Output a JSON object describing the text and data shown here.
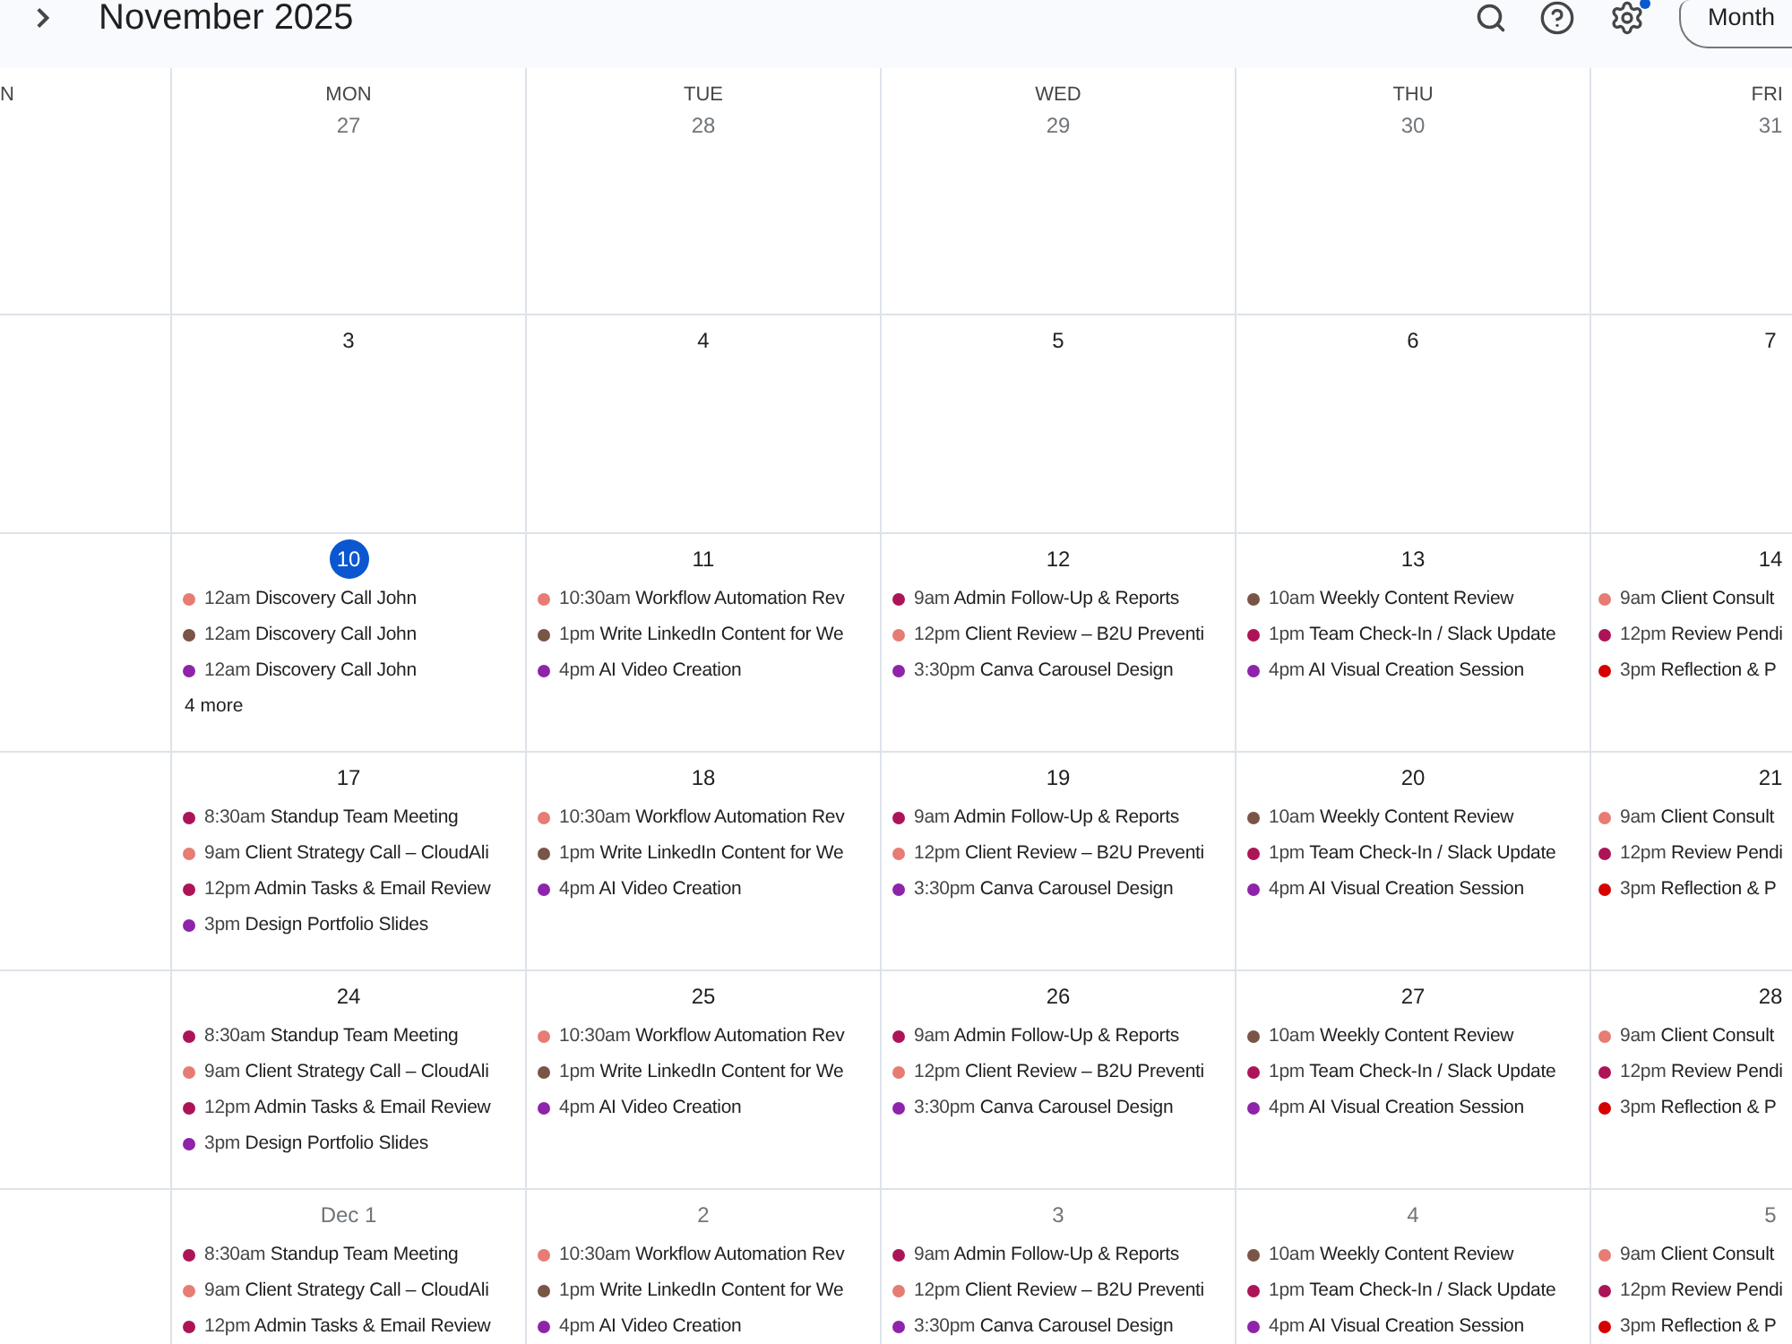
{
  "toolbar": {
    "title": "November 2025",
    "settings_badge": true,
    "view_button": "Month"
  },
  "weekdays": [
    "N",
    "MON",
    "TUE",
    "WED",
    "THU",
    "FRI"
  ],
  "weeks": [
    {
      "days": [
        {
          "date": "27",
          "outside_month": true,
          "today": false
        },
        {
          "date": "28",
          "outside_month": true,
          "today": false
        },
        {
          "date": "29",
          "outside_month": true,
          "today": false
        },
        {
          "date": "30",
          "outside_month": true,
          "today": false
        },
        {
          "date": "31",
          "outside_month": true,
          "today": false
        }
      ]
    },
    {
      "days": [
        {
          "date": "3",
          "outside_month": false,
          "today": false
        },
        {
          "date": "4",
          "outside_month": false,
          "today": false
        },
        {
          "date": "5",
          "outside_month": false,
          "today": false
        },
        {
          "date": "6",
          "outside_month": false,
          "today": false
        },
        {
          "date": "7",
          "outside_month": false,
          "today": false
        }
      ]
    },
    {
      "days": [
        {
          "date": "10",
          "outside_month": false,
          "today": true,
          "events": [
            {
              "time": "12am",
              "title": "Discovery Call John",
              "color": "#e67c73"
            },
            {
              "time": "12am",
              "title": "Discovery Call John",
              "color": "#795548"
            },
            {
              "time": "12am",
              "title": "Discovery Call John",
              "color": "#8e24aa"
            }
          ],
          "more": "4 more"
        },
        {
          "date": "11",
          "outside_month": false,
          "today": false,
          "events": [
            {
              "time": "10:30am",
              "title": "Workflow Automation Rev",
              "color": "#e67c73"
            },
            {
              "time": "1pm",
              "title": "Write LinkedIn Content for We",
              "color": "#795548"
            },
            {
              "time": "4pm",
              "title": "AI Video Creation",
              "color": "#8e24aa"
            }
          ]
        },
        {
          "date": "12",
          "outside_month": false,
          "today": false,
          "events": [
            {
              "time": "9am",
              "title": "Admin Follow-Up & Reports",
              "color": "#ad1457"
            },
            {
              "time": "12pm",
              "title": "Client Review – B2U Preventi",
              "color": "#e67c73"
            },
            {
              "time": "3:30pm",
              "title": "Canva Carousel Design",
              "color": "#8e24aa"
            }
          ]
        },
        {
          "date": "13",
          "outside_month": false,
          "today": false,
          "events": [
            {
              "time": "10am",
              "title": "Weekly Content Review",
              "color": "#795548"
            },
            {
              "time": "1pm",
              "title": "Team Check-In / Slack Update",
              "color": "#ad1457"
            },
            {
              "time": "4pm",
              "title": "AI Visual Creation Session",
              "color": "#8e24aa"
            }
          ]
        },
        {
          "date": "14",
          "outside_month": false,
          "today": false,
          "events": [
            {
              "time": "9am",
              "title": "Client Consult",
              "color": "#e67c73"
            },
            {
              "time": "12pm",
              "title": "Review Pendi",
              "color": "#ad1457"
            },
            {
              "time": "3pm",
              "title": "Reflection & P",
              "color": "#d50000"
            }
          ]
        }
      ]
    },
    {
      "days": [
        {
          "date": "17",
          "outside_month": false,
          "today": false,
          "events": [
            {
              "time": "8:30am",
              "title": "Standup Team Meeting",
              "color": "#ad1457"
            },
            {
              "time": "9am",
              "title": "Client Strategy Call – CloudAli",
              "color": "#e67c73"
            },
            {
              "time": "12pm",
              "title": "Admin Tasks & Email Review",
              "color": "#ad1457"
            },
            {
              "time": "3pm",
              "title": "Design Portfolio Slides",
              "color": "#8e24aa"
            }
          ]
        },
        {
          "date": "18",
          "outside_month": false,
          "today": false,
          "events": [
            {
              "time": "10:30am",
              "title": "Workflow Automation Rev",
              "color": "#e67c73"
            },
            {
              "time": "1pm",
              "title": "Write LinkedIn Content for We",
              "color": "#795548"
            },
            {
              "time": "4pm",
              "title": "AI Video Creation",
              "color": "#8e24aa"
            }
          ]
        },
        {
          "date": "19",
          "outside_month": false,
          "today": false,
          "events": [
            {
              "time": "9am",
              "title": "Admin Follow-Up & Reports",
              "color": "#ad1457"
            },
            {
              "time": "12pm",
              "title": "Client Review – B2U Preventi",
              "color": "#e67c73"
            },
            {
              "time": "3:30pm",
              "title": "Canva Carousel Design",
              "color": "#8e24aa"
            }
          ]
        },
        {
          "date": "20",
          "outside_month": false,
          "today": false,
          "events": [
            {
              "time": "10am",
              "title": "Weekly Content Review",
              "color": "#795548"
            },
            {
              "time": "1pm",
              "title": "Team Check-In / Slack Update",
              "color": "#ad1457"
            },
            {
              "time": "4pm",
              "title": "AI Visual Creation Session",
              "color": "#8e24aa"
            }
          ]
        },
        {
          "date": "21",
          "outside_month": false,
          "today": false,
          "events": [
            {
              "time": "9am",
              "title": "Client Consult",
              "color": "#e67c73"
            },
            {
              "time": "12pm",
              "title": "Review Pendi",
              "color": "#ad1457"
            },
            {
              "time": "3pm",
              "title": "Reflection & P",
              "color": "#d50000"
            }
          ]
        }
      ]
    },
    {
      "days": [
        {
          "date": "24",
          "outside_month": false,
          "today": false,
          "events": [
            {
              "time": "8:30am",
              "title": "Standup Team Meeting",
              "color": "#ad1457"
            },
            {
              "time": "9am",
              "title": "Client Strategy Call – CloudAli",
              "color": "#e67c73"
            },
            {
              "time": "12pm",
              "title": "Admin Tasks & Email Review",
              "color": "#ad1457"
            },
            {
              "time": "3pm",
              "title": "Design Portfolio Slides",
              "color": "#8e24aa"
            }
          ]
        },
        {
          "date": "25",
          "outside_month": false,
          "today": false,
          "events": [
            {
              "time": "10:30am",
              "title": "Workflow Automation Rev",
              "color": "#e67c73"
            },
            {
              "time": "1pm",
              "title": "Write LinkedIn Content for We",
              "color": "#795548"
            },
            {
              "time": "4pm",
              "title": "AI Video Creation",
              "color": "#8e24aa"
            }
          ]
        },
        {
          "date": "26",
          "outside_month": false,
          "today": false,
          "events": [
            {
              "time": "9am",
              "title": "Admin Follow-Up & Reports",
              "color": "#ad1457"
            },
            {
              "time": "12pm",
              "title": "Client Review – B2U Preventi",
              "color": "#e67c73"
            },
            {
              "time": "3:30pm",
              "title": "Canva Carousel Design",
              "color": "#8e24aa"
            }
          ]
        },
        {
          "date": "27",
          "outside_month": false,
          "today": false,
          "events": [
            {
              "time": "10am",
              "title": "Weekly Content Review",
              "color": "#795548"
            },
            {
              "time": "1pm",
              "title": "Team Check-In / Slack Update",
              "color": "#ad1457"
            },
            {
              "time": "4pm",
              "title": "AI Visual Creation Session",
              "color": "#8e24aa"
            }
          ]
        },
        {
          "date": "28",
          "outside_month": false,
          "today": false,
          "events": [
            {
              "time": "9am",
              "title": "Client Consult",
              "color": "#e67c73"
            },
            {
              "time": "12pm",
              "title": "Review Pendi",
              "color": "#ad1457"
            },
            {
              "time": "3pm",
              "title": "Reflection & P",
              "color": "#d50000"
            }
          ]
        }
      ]
    },
    {
      "days": [
        {
          "date": "Dec 1",
          "outside_month": true,
          "today": false,
          "events": [
            {
              "time": "8:30am",
              "title": "Standup Team Meeting",
              "color": "#ad1457"
            },
            {
              "time": "9am",
              "title": "Client Strategy Call – CloudAli",
              "color": "#e67c73"
            },
            {
              "time": "12pm",
              "title": "Admin Tasks & Email Review",
              "color": "#ad1457"
            }
          ]
        },
        {
          "date": "2",
          "outside_month": true,
          "today": false,
          "events": [
            {
              "time": "10:30am",
              "title": "Workflow Automation Rev",
              "color": "#e67c73"
            },
            {
              "time": "1pm",
              "title": "Write LinkedIn Content for We",
              "color": "#795548"
            },
            {
              "time": "4pm",
              "title": "AI Video Creation",
              "color": "#8e24aa"
            }
          ]
        },
        {
          "date": "3",
          "outside_month": true,
          "today": false,
          "events": [
            {
              "time": "9am",
              "title": "Admin Follow-Up & Reports",
              "color": "#ad1457"
            },
            {
              "time": "12pm",
              "title": "Client Review – B2U Preventi",
              "color": "#e67c73"
            },
            {
              "time": "3:30pm",
              "title": "Canva Carousel Design",
              "color": "#8e24aa"
            }
          ]
        },
        {
          "date": "4",
          "outside_month": true,
          "today": false,
          "events": [
            {
              "time": "10am",
              "title": "Weekly Content Review",
              "color": "#795548"
            },
            {
              "time": "1pm",
              "title": "Team Check-In / Slack Update",
              "color": "#ad1457"
            },
            {
              "time": "4pm",
              "title": "AI Visual Creation Session",
              "color": "#8e24aa"
            }
          ]
        },
        {
          "date": "5",
          "outside_month": true,
          "today": false,
          "events": [
            {
              "time": "9am",
              "title": "Client Consult",
              "color": "#e67c73"
            },
            {
              "time": "12pm",
              "title": "Review Pendi",
              "color": "#ad1457"
            },
            {
              "time": "3pm",
              "title": "Reflection & P",
              "color": "#d50000"
            }
          ]
        }
      ]
    }
  ]
}
